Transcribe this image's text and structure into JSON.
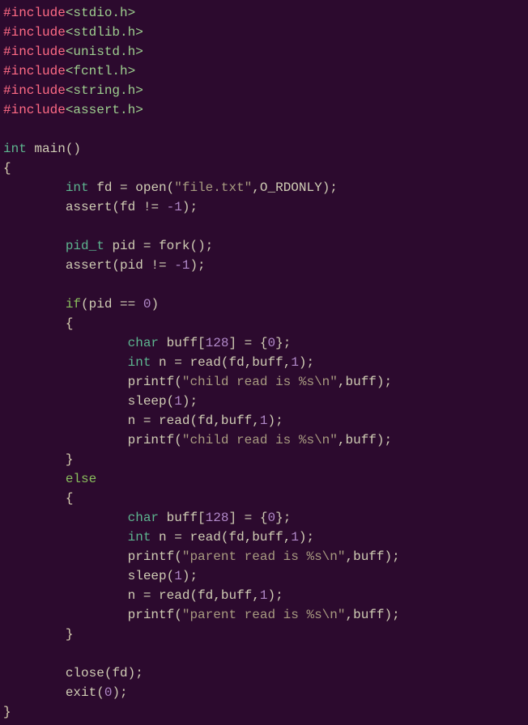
{
  "code": {
    "lines": [
      [
        {
          "cls": "pp",
          "t": "#include"
        },
        {
          "cls": "hdr",
          "t": "<stdio.h>"
        }
      ],
      [
        {
          "cls": "pp",
          "t": "#include"
        },
        {
          "cls": "hdr",
          "t": "<stdlib.h>"
        }
      ],
      [
        {
          "cls": "pp",
          "t": "#include"
        },
        {
          "cls": "hdr",
          "t": "<unistd.h>"
        }
      ],
      [
        {
          "cls": "pp",
          "t": "#include"
        },
        {
          "cls": "hdr",
          "t": "<fcntl.h>"
        }
      ],
      [
        {
          "cls": "pp",
          "t": "#include"
        },
        {
          "cls": "hdr",
          "t": "<string.h>"
        }
      ],
      [
        {
          "cls": "pp",
          "t": "#include"
        },
        {
          "cls": "hdr",
          "t": "<assert.h>"
        }
      ],
      [],
      [
        {
          "cls": "ty",
          "t": "int"
        },
        {
          "cls": "op",
          "t": " "
        },
        {
          "cls": "fn",
          "t": "main"
        },
        {
          "cls": "op",
          "t": "()"
        }
      ],
      [
        {
          "cls": "br",
          "t": "{"
        }
      ],
      [
        {
          "cls": "op",
          "t": "        "
        },
        {
          "cls": "ty",
          "t": "int"
        },
        {
          "cls": "op",
          "t": " "
        },
        {
          "cls": "id",
          "t": "fd"
        },
        {
          "cls": "op",
          "t": " = "
        },
        {
          "cls": "fn",
          "t": "open"
        },
        {
          "cls": "op",
          "t": "("
        },
        {
          "cls": "str",
          "t": "\"file.txt\""
        },
        {
          "cls": "op",
          "t": ","
        },
        {
          "cls": "const",
          "t": "O_RDONLY"
        },
        {
          "cls": "op",
          "t": ");"
        }
      ],
      [
        {
          "cls": "op",
          "t": "        "
        },
        {
          "cls": "fn",
          "t": "assert"
        },
        {
          "cls": "op",
          "t": "("
        },
        {
          "cls": "id",
          "t": "fd"
        },
        {
          "cls": "op",
          "t": " != "
        },
        {
          "cls": "num",
          "t": "-1"
        },
        {
          "cls": "op",
          "t": ");"
        }
      ],
      [],
      [
        {
          "cls": "op",
          "t": "        "
        },
        {
          "cls": "ty",
          "t": "pid_t"
        },
        {
          "cls": "op",
          "t": " "
        },
        {
          "cls": "id",
          "t": "pid"
        },
        {
          "cls": "op",
          "t": " = "
        },
        {
          "cls": "fn",
          "t": "fork"
        },
        {
          "cls": "op",
          "t": "();"
        }
      ],
      [
        {
          "cls": "op",
          "t": "        "
        },
        {
          "cls": "fn",
          "t": "assert"
        },
        {
          "cls": "op",
          "t": "("
        },
        {
          "cls": "id",
          "t": "pid"
        },
        {
          "cls": "op",
          "t": " != "
        },
        {
          "cls": "num",
          "t": "-1"
        },
        {
          "cls": "op",
          "t": ");"
        }
      ],
      [],
      [
        {
          "cls": "op",
          "t": "        "
        },
        {
          "cls": "kw",
          "t": "if"
        },
        {
          "cls": "op",
          "t": "("
        },
        {
          "cls": "id",
          "t": "pid"
        },
        {
          "cls": "op",
          "t": " == "
        },
        {
          "cls": "num",
          "t": "0"
        },
        {
          "cls": "op",
          "t": ")"
        }
      ],
      [
        {
          "cls": "op",
          "t": "        "
        },
        {
          "cls": "br",
          "t": "{"
        }
      ],
      [
        {
          "cls": "op",
          "t": "                "
        },
        {
          "cls": "ty",
          "t": "char"
        },
        {
          "cls": "op",
          "t": " "
        },
        {
          "cls": "id",
          "t": "buff"
        },
        {
          "cls": "op",
          "t": "["
        },
        {
          "cls": "num",
          "t": "128"
        },
        {
          "cls": "op",
          "t": "] = {"
        },
        {
          "cls": "num",
          "t": "0"
        },
        {
          "cls": "op",
          "t": "};"
        }
      ],
      [
        {
          "cls": "op",
          "t": "                "
        },
        {
          "cls": "ty",
          "t": "int"
        },
        {
          "cls": "op",
          "t": " "
        },
        {
          "cls": "id",
          "t": "n"
        },
        {
          "cls": "op",
          "t": " = "
        },
        {
          "cls": "fn",
          "t": "read"
        },
        {
          "cls": "op",
          "t": "("
        },
        {
          "cls": "id",
          "t": "fd"
        },
        {
          "cls": "op",
          "t": ","
        },
        {
          "cls": "id",
          "t": "buff"
        },
        {
          "cls": "op",
          "t": ","
        },
        {
          "cls": "num",
          "t": "1"
        },
        {
          "cls": "op",
          "t": ");"
        }
      ],
      [
        {
          "cls": "op",
          "t": "                "
        },
        {
          "cls": "fn",
          "t": "printf"
        },
        {
          "cls": "op",
          "t": "("
        },
        {
          "cls": "str",
          "t": "\"child read is %s\\n\""
        },
        {
          "cls": "op",
          "t": ","
        },
        {
          "cls": "id",
          "t": "buff"
        },
        {
          "cls": "op",
          "t": ");"
        }
      ],
      [
        {
          "cls": "op",
          "t": "                "
        },
        {
          "cls": "fn",
          "t": "sleep"
        },
        {
          "cls": "op",
          "t": "("
        },
        {
          "cls": "num",
          "t": "1"
        },
        {
          "cls": "op",
          "t": ");"
        }
      ],
      [
        {
          "cls": "op",
          "t": "                "
        },
        {
          "cls": "id",
          "t": "n"
        },
        {
          "cls": "op",
          "t": " = "
        },
        {
          "cls": "fn",
          "t": "read"
        },
        {
          "cls": "op",
          "t": "("
        },
        {
          "cls": "id",
          "t": "fd"
        },
        {
          "cls": "op",
          "t": ","
        },
        {
          "cls": "id",
          "t": "buff"
        },
        {
          "cls": "op",
          "t": ","
        },
        {
          "cls": "num",
          "t": "1"
        },
        {
          "cls": "op",
          "t": ");"
        }
      ],
      [
        {
          "cls": "op",
          "t": "                "
        },
        {
          "cls": "fn",
          "t": "printf"
        },
        {
          "cls": "op",
          "t": "("
        },
        {
          "cls": "str",
          "t": "\"child read is %s\\n\""
        },
        {
          "cls": "op",
          "t": ","
        },
        {
          "cls": "id",
          "t": "buff"
        },
        {
          "cls": "op",
          "t": ");"
        }
      ],
      [
        {
          "cls": "op",
          "t": "        "
        },
        {
          "cls": "br",
          "t": "}"
        }
      ],
      [
        {
          "cls": "op",
          "t": "        "
        },
        {
          "cls": "kw",
          "t": "else"
        }
      ],
      [
        {
          "cls": "op",
          "t": "        "
        },
        {
          "cls": "br",
          "t": "{"
        }
      ],
      [
        {
          "cls": "op",
          "t": "                "
        },
        {
          "cls": "ty",
          "t": "char"
        },
        {
          "cls": "op",
          "t": " "
        },
        {
          "cls": "id",
          "t": "buff"
        },
        {
          "cls": "op",
          "t": "["
        },
        {
          "cls": "num",
          "t": "128"
        },
        {
          "cls": "op",
          "t": "] = {"
        },
        {
          "cls": "num",
          "t": "0"
        },
        {
          "cls": "op",
          "t": "};"
        }
      ],
      [
        {
          "cls": "op",
          "t": "                "
        },
        {
          "cls": "ty",
          "t": "int"
        },
        {
          "cls": "op",
          "t": " "
        },
        {
          "cls": "id",
          "t": "n"
        },
        {
          "cls": "op",
          "t": " = "
        },
        {
          "cls": "fn",
          "t": "read"
        },
        {
          "cls": "op",
          "t": "("
        },
        {
          "cls": "id",
          "t": "fd"
        },
        {
          "cls": "op",
          "t": ","
        },
        {
          "cls": "id",
          "t": "buff"
        },
        {
          "cls": "op",
          "t": ","
        },
        {
          "cls": "num",
          "t": "1"
        },
        {
          "cls": "op",
          "t": ");"
        }
      ],
      [
        {
          "cls": "op",
          "t": "                "
        },
        {
          "cls": "fn",
          "t": "printf"
        },
        {
          "cls": "op",
          "t": "("
        },
        {
          "cls": "str",
          "t": "\"parent read is %s\\n\""
        },
        {
          "cls": "op",
          "t": ","
        },
        {
          "cls": "id",
          "t": "buff"
        },
        {
          "cls": "op",
          "t": ");"
        }
      ],
      [
        {
          "cls": "op",
          "t": "                "
        },
        {
          "cls": "fn",
          "t": "sleep"
        },
        {
          "cls": "op",
          "t": "("
        },
        {
          "cls": "num",
          "t": "1"
        },
        {
          "cls": "op",
          "t": ");"
        }
      ],
      [
        {
          "cls": "op",
          "t": "                "
        },
        {
          "cls": "id",
          "t": "n"
        },
        {
          "cls": "op",
          "t": " = "
        },
        {
          "cls": "fn",
          "t": "read"
        },
        {
          "cls": "op",
          "t": "("
        },
        {
          "cls": "id",
          "t": "fd"
        },
        {
          "cls": "op",
          "t": ","
        },
        {
          "cls": "id",
          "t": "buff"
        },
        {
          "cls": "op",
          "t": ","
        },
        {
          "cls": "num",
          "t": "1"
        },
        {
          "cls": "op",
          "t": ");"
        }
      ],
      [
        {
          "cls": "op",
          "t": "                "
        },
        {
          "cls": "fn",
          "t": "printf"
        },
        {
          "cls": "op",
          "t": "("
        },
        {
          "cls": "str",
          "t": "\"parent read is %s\\n\""
        },
        {
          "cls": "op",
          "t": ","
        },
        {
          "cls": "id",
          "t": "buff"
        },
        {
          "cls": "op",
          "t": ");"
        }
      ],
      [
        {
          "cls": "op",
          "t": "        "
        },
        {
          "cls": "br",
          "t": "}"
        }
      ],
      [],
      [
        {
          "cls": "op",
          "t": "        "
        },
        {
          "cls": "fn",
          "t": "close"
        },
        {
          "cls": "op",
          "t": "("
        },
        {
          "cls": "id",
          "t": "fd"
        },
        {
          "cls": "op",
          "t": ");"
        }
      ],
      [
        {
          "cls": "op",
          "t": "        "
        },
        {
          "cls": "fn",
          "t": "exit"
        },
        {
          "cls": "op",
          "t": "("
        },
        {
          "cls": "num",
          "t": "0"
        },
        {
          "cls": "op",
          "t": ");"
        }
      ],
      [
        {
          "cls": "br",
          "t": "}"
        }
      ]
    ]
  }
}
